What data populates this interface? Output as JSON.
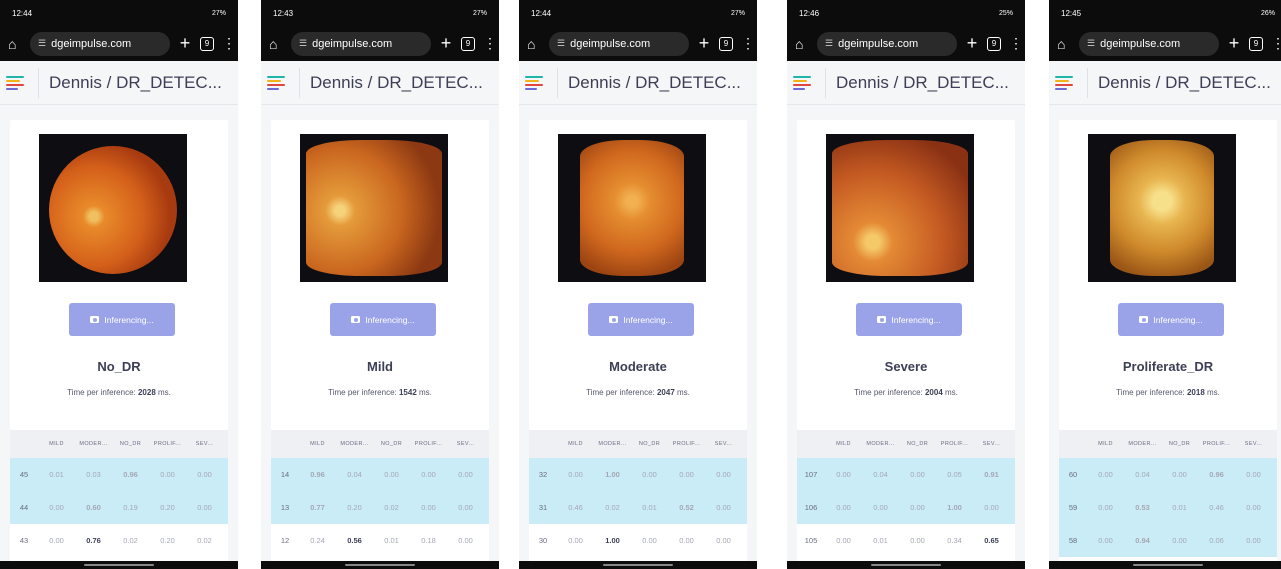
{
  "url_text": "dgeimpulse.com",
  "project_title": "Dennis / DR_DETEC...",
  "button_label": "Inferencing...",
  "time_prefix": "Time per inference: ",
  "time_suffix": " ms.",
  "columns": [
    "MILD",
    "MODER...",
    "NO_DR",
    "PROLIF...",
    "SEV..."
  ],
  "screens": [
    {
      "status_time": "12:44",
      "status_right": "27%",
      "tab_count": "9",
      "result": "No_DR",
      "time_ms": "2028",
      "rows": [
        {
          "id": "45",
          "vals": [
            "0.01",
            "0.03",
            "0.96",
            "0.00",
            "0.00"
          ],
          "highlight": true,
          "strong": 2
        },
        {
          "id": "44",
          "vals": [
            "0.00",
            "0.60",
            "0.19",
            "0.20",
            "0.00"
          ],
          "highlight": true,
          "strong": 1
        },
        {
          "id": "43",
          "vals": [
            "0.00",
            "0.76",
            "0.02",
            "0.20",
            "0.02"
          ],
          "highlight": false,
          "strong": 1
        }
      ]
    },
    {
      "status_time": "12:43",
      "status_right": "27%",
      "tab_count": "9",
      "result": "Mild",
      "time_ms": "1542",
      "rows": [
        {
          "id": "14",
          "vals": [
            "0.96",
            "0.04",
            "0.00",
            "0.00",
            "0.00"
          ],
          "highlight": true,
          "strong": 0
        },
        {
          "id": "13",
          "vals": [
            "0.77",
            "0.20",
            "0.02",
            "0.00",
            "0.00"
          ],
          "highlight": true,
          "strong": 0
        },
        {
          "id": "12",
          "vals": [
            "0.24",
            "0.56",
            "0.01",
            "0.18",
            "0.00"
          ],
          "highlight": false,
          "strong": 1
        }
      ]
    },
    {
      "status_time": "12:44",
      "status_right": "27%",
      "tab_count": "9",
      "result": "Moderate",
      "time_ms": "2047",
      "rows": [
        {
          "id": "32",
          "vals": [
            "0.00",
            "1.00",
            "0.00",
            "0.00",
            "0.00"
          ],
          "highlight": true,
          "strong": 1
        },
        {
          "id": "31",
          "vals": [
            "0.46",
            "0.02",
            "0.01",
            "0.52",
            "0.00"
          ],
          "highlight": true,
          "strong": 3
        },
        {
          "id": "30",
          "vals": [
            "0.00",
            "1.00",
            "0.00",
            "0.00",
            "0.00"
          ],
          "highlight": false,
          "strong": 1
        }
      ]
    },
    {
      "status_time": "12:46",
      "status_right": "25%",
      "tab_count": "9",
      "result": "Severe",
      "time_ms": "2004",
      "rows": [
        {
          "id": "107",
          "vals": [
            "0.00",
            "0.04",
            "0.00",
            "0.05",
            "0.91"
          ],
          "highlight": true,
          "strong": 4
        },
        {
          "id": "106",
          "vals": [
            "0.00",
            "0.00",
            "0.00",
            "1.00",
            "0.00"
          ],
          "highlight": true,
          "strong": 3
        },
        {
          "id": "105",
          "vals": [
            "0.00",
            "0.01",
            "0.00",
            "0.34",
            "0.65"
          ],
          "highlight": false,
          "strong": 4
        }
      ]
    },
    {
      "status_time": "12:45",
      "status_right": "26%",
      "tab_count": "9",
      "result": "Proliferate_DR",
      "time_ms": "2018",
      "rows": [
        {
          "id": "60",
          "vals": [
            "0.00",
            "0.04",
            "0.00",
            "0.96",
            "0.00"
          ],
          "highlight": true,
          "strong": 3
        },
        {
          "id": "59",
          "vals": [
            "0.00",
            "0.53",
            "0.01",
            "0.46",
            "0.00"
          ],
          "highlight": true,
          "strong": 1
        },
        {
          "id": "58",
          "vals": [
            "0.00",
            "0.94",
            "0.00",
            "0.06",
            "0.00"
          ],
          "highlight": true,
          "strong": 1
        }
      ]
    }
  ]
}
